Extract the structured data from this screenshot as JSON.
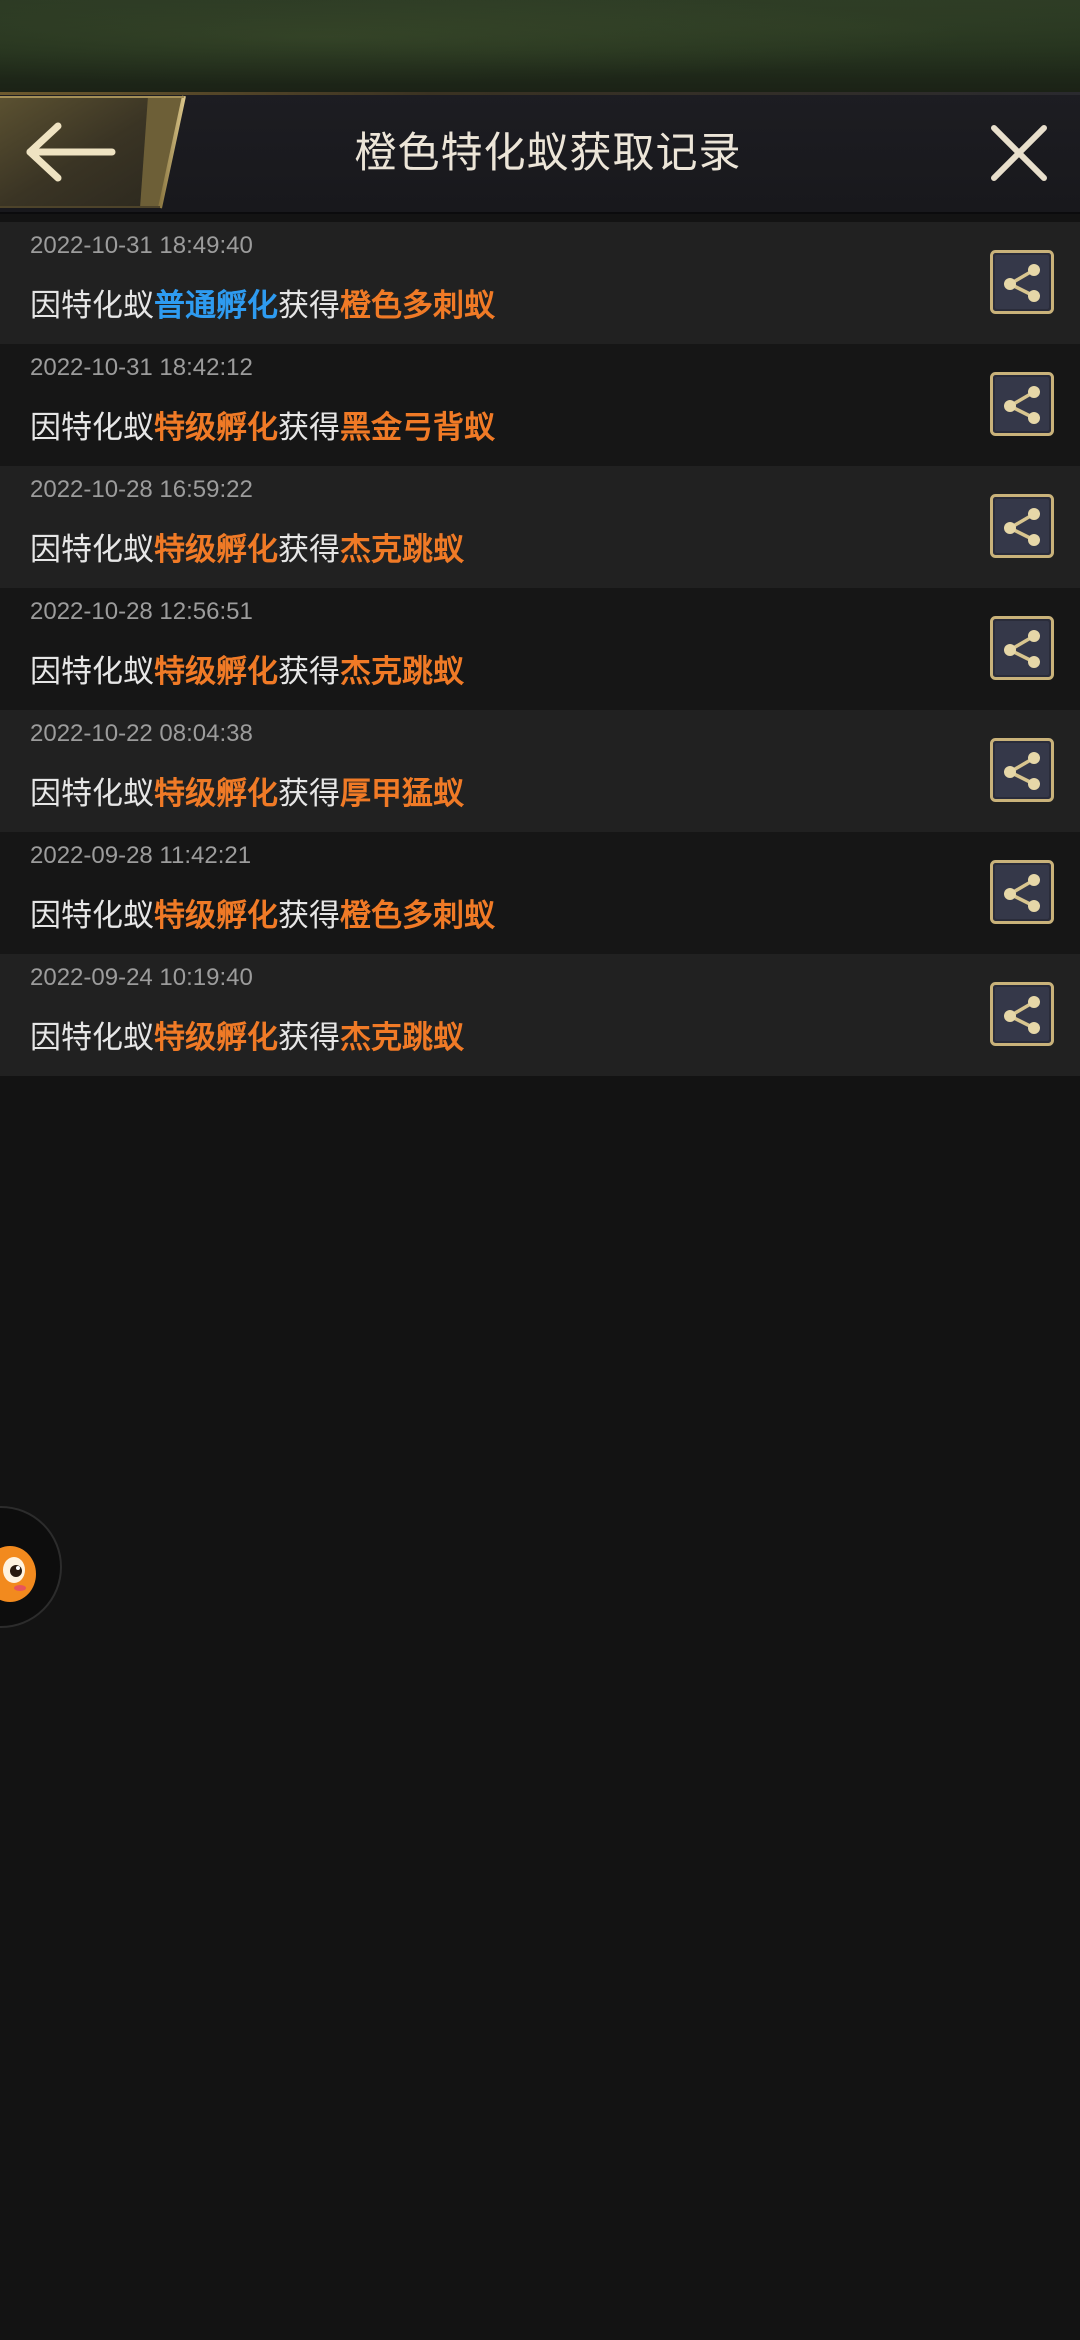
{
  "header": {
    "title": "橙色特化蚁获取记录",
    "back_icon": "arrow-left-icon",
    "close_icon": "close-icon"
  },
  "records": [
    {
      "time": "2022-10-31 18:49:40",
      "prefix": "因特化蚁",
      "method": "普通孵化",
      "method_color": "#2e9bf0",
      "middle": "获得",
      "result": "橙色多刺蚁"
    },
    {
      "time": "2022-10-31 18:42:12",
      "prefix": "因特化蚁",
      "method": "特级孵化",
      "method_color": "#f07a26",
      "middle": "获得",
      "result": "黑金弓背蚁"
    },
    {
      "time": "2022-10-28 16:59:22",
      "prefix": "因特化蚁",
      "method": "特级孵化",
      "method_color": "#f07a26",
      "middle": "获得",
      "result": "杰克跳蚁"
    },
    {
      "time": "2022-10-28 12:56:51",
      "prefix": "因特化蚁",
      "method": "特级孵化",
      "method_color": "#f07a26",
      "middle": "获得",
      "result": "杰克跳蚁"
    },
    {
      "time": "2022-10-22 08:04:38",
      "prefix": "因特化蚁",
      "method": "特级孵化",
      "method_color": "#f07a26",
      "middle": "获得",
      "result": "厚甲猛蚁"
    },
    {
      "time": "2022-09-28 11:42:21",
      "prefix": "因特化蚁",
      "method": "特级孵化",
      "method_color": "#f07a26",
      "middle": "获得",
      "result": "橙色多刺蚁"
    },
    {
      "time": "2022-09-24 10:19:40",
      "prefix": "因特化蚁",
      "method": "特级孵化",
      "method_color": "#f07a26",
      "middle": "获得",
      "result": "杰克跳蚁"
    }
  ],
  "colors": {
    "accent_gold": "#c9b27a",
    "result_orange": "#f07a26",
    "method_blue": "#2e9bf0",
    "background": "#131313"
  },
  "share_icon": "share-icon",
  "floating_assistant_icon": "mascot-icon"
}
